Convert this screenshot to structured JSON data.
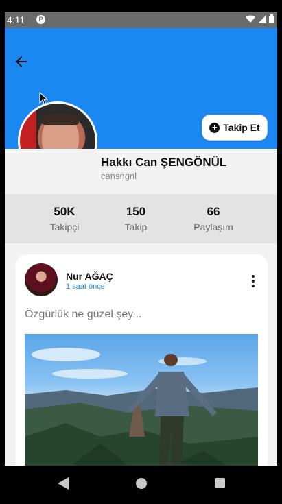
{
  "statusbar": {
    "time": "4:11",
    "icons": [
      "app-notification-icon",
      "wifi-icon",
      "signal-icon",
      "battery-icon"
    ]
  },
  "header": {
    "back_icon": "arrow-left-icon",
    "cover_color": "#1a88f0"
  },
  "profile": {
    "name": "Hakkı Can ŞENGÖNÜL",
    "username": "cansngnl",
    "follow_button": "Takip Et",
    "stats": [
      {
        "value": "50K",
        "label": "Takipçi"
      },
      {
        "value": "150",
        "label": "Takip"
      },
      {
        "value": "66",
        "label": "Paylaşım"
      }
    ]
  },
  "post": {
    "author": "Nur AĞAÇ",
    "time": "1 saat önce",
    "text": "Özgürlük ne güzel şey...",
    "menu_icon": "more-vertical-icon"
  },
  "navbar": {
    "icons": [
      "back-triangle-icon",
      "home-circle-icon",
      "recents-square-icon"
    ]
  },
  "colors": {
    "accent": "#1a88f0",
    "background": "#f2f2f2",
    "stats_background": "#e3e3e3"
  }
}
